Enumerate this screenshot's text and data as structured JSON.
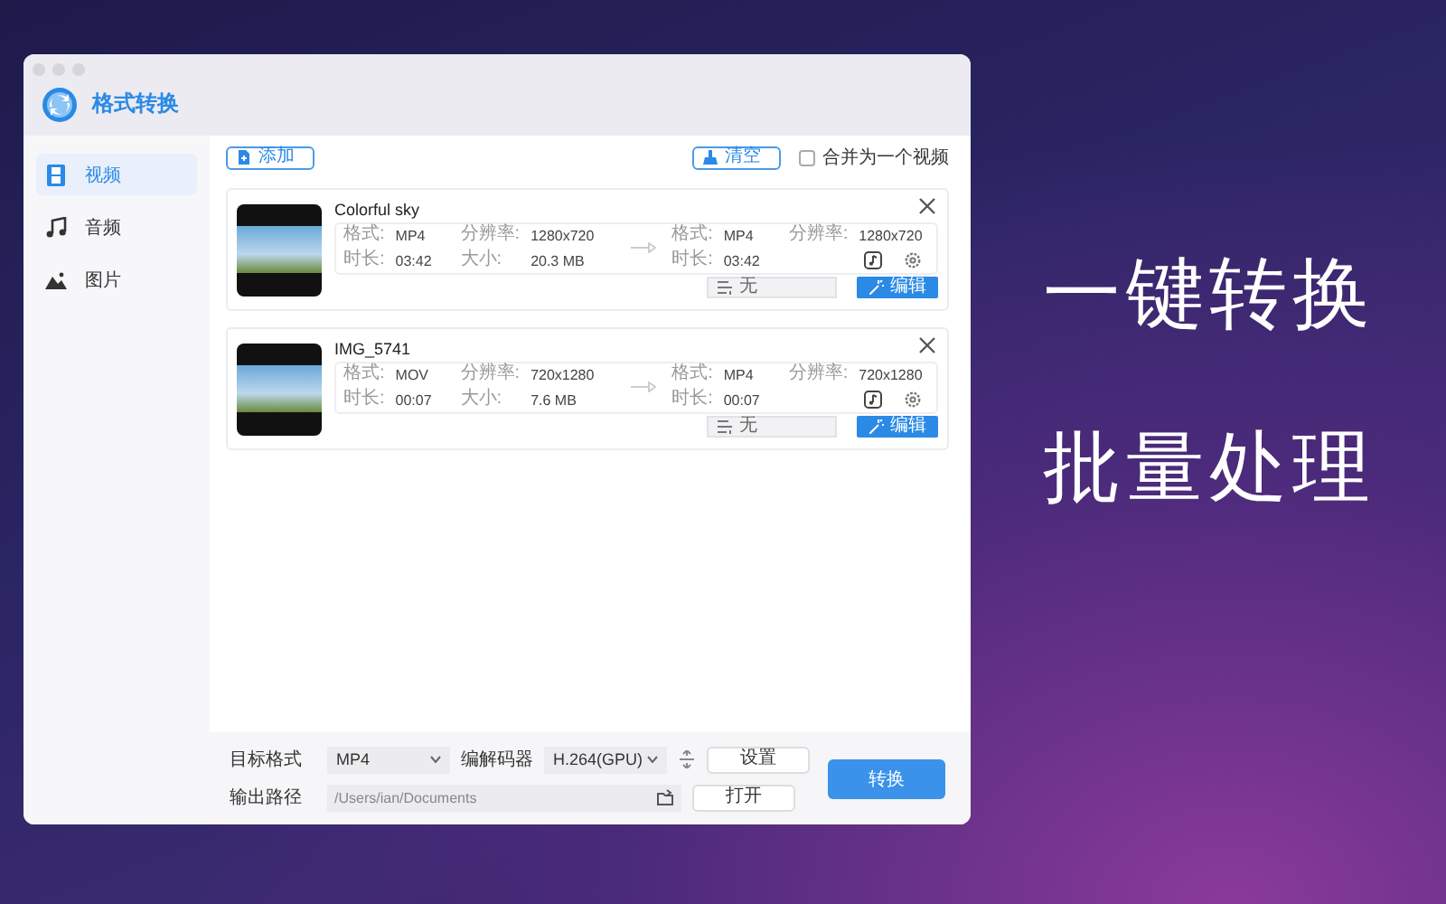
{
  "window": {
    "title": "格式转换"
  },
  "sidebar": {
    "items": [
      {
        "label": "视频",
        "selected": true,
        "kind": "video"
      },
      {
        "label": "音频",
        "selected": false,
        "kind": "audio"
      },
      {
        "label": "图片",
        "selected": false,
        "kind": "image"
      }
    ]
  },
  "toolbar": {
    "add_button": "添加",
    "clear_button": "清空",
    "merge_checkbox": {
      "label": "合并为一个视频",
      "checked": false
    }
  },
  "files": [
    {
      "name": "Colorful sky",
      "source": {
        "format_label": "格式:",
        "format": "MP4",
        "resolution_label": "分辨率:",
        "resolution": "1280x720",
        "duration_label": "时长:",
        "duration": "03:42",
        "size_label": "大小:",
        "size": "20.3 MB"
      },
      "target": {
        "format_label": "格式:",
        "format": "MP4",
        "resolution_label": "分辨率:",
        "resolution": "1280x720",
        "duration_label": "时长:",
        "duration": "03:42"
      },
      "subtitle": "无",
      "edit_button": "编辑"
    },
    {
      "name": "IMG_5741",
      "source": {
        "format_label": "格式:",
        "format": "MOV",
        "resolution_label": "分辨率:",
        "resolution": "720x1280",
        "duration_label": "时长:",
        "duration": "00:07",
        "size_label": "大小:",
        "size": "7.6 MB"
      },
      "target": {
        "format_label": "格式:",
        "format": "MP4",
        "resolution_label": "分辨率:",
        "resolution": "720x1280",
        "duration_label": "时长:",
        "duration": "00:07"
      },
      "subtitle": "无",
      "edit_button": "编辑"
    }
  ],
  "bottom": {
    "target_format_label": "目标格式",
    "target_format": "MP4",
    "codec_label": "编解码器",
    "codec": "H.264(GPU)",
    "settings_button": "设置",
    "output_path_label": "输出路径",
    "output_path": "/Users/ian/Documents",
    "open_button": "打开",
    "convert_button": "转换"
  },
  "promo": [
    "一键转换",
    "批量处理"
  ]
}
